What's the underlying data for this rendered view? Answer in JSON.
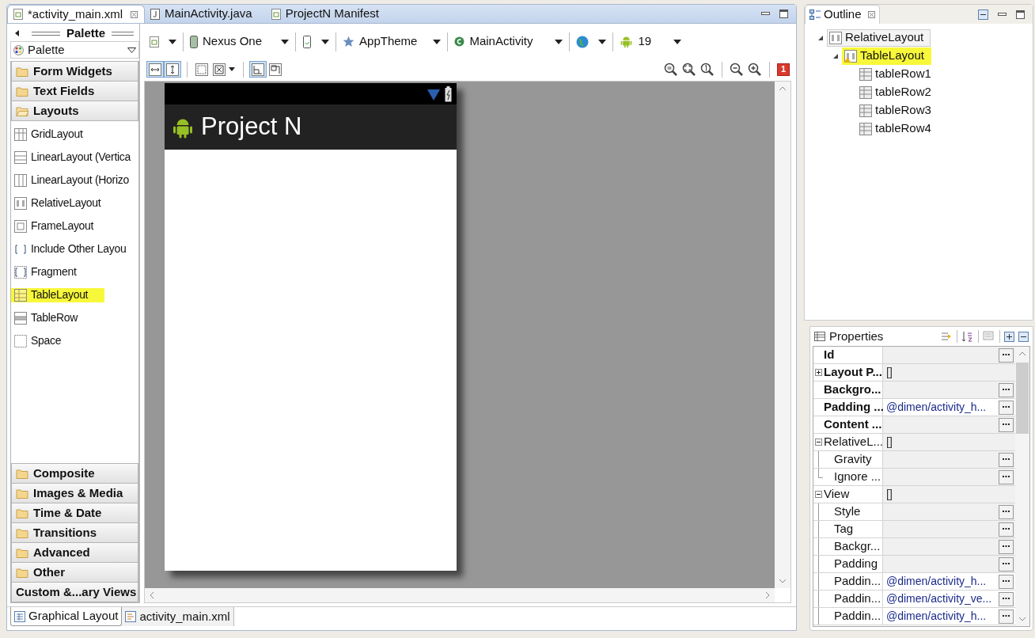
{
  "editor": {
    "tabs": [
      {
        "label": "*activity_main.xml",
        "selected": true
      },
      {
        "label": "MainActivity.java",
        "selected": false
      },
      {
        "label": "ProjectN Manifest",
        "selected": false
      }
    ],
    "palette": {
      "title": "Palette",
      "dropdown": "Palette",
      "groups": [
        {
          "label": "Form Widgets",
          "kind": "folder",
          "expanded": false
        },
        {
          "label": "Text Fields",
          "kind": "folder",
          "expanded": false
        },
        {
          "label": "Layouts",
          "kind": "folder",
          "expanded": true,
          "items": [
            {
              "label": "GridLayout",
              "highlighted": false
            },
            {
              "label": "LinearLayout (Vertica",
              "highlighted": false
            },
            {
              "label": "LinearLayout (Horizo",
              "highlighted": false
            },
            {
              "label": "RelativeLayout",
              "highlighted": false
            },
            {
              "label": "FrameLayout",
              "highlighted": false
            },
            {
              "label": "Include Other Layou",
              "highlighted": false
            },
            {
              "label": "Fragment",
              "highlighted": false
            },
            {
              "label": "TableLayout",
              "highlighted": true
            },
            {
              "label": "TableRow",
              "highlighted": false
            },
            {
              "label": "Space",
              "highlighted": false
            }
          ]
        },
        {
          "label": "Composite",
          "kind": "folder",
          "expanded": false
        },
        {
          "label": "Images & Media",
          "kind": "folder",
          "expanded": false
        },
        {
          "label": "Time & Date",
          "kind": "folder",
          "expanded": false
        },
        {
          "label": "Transitions",
          "kind": "folder",
          "expanded": false
        },
        {
          "label": "Advanced",
          "kind": "folder",
          "expanded": false
        },
        {
          "label": "Other",
          "kind": "folder",
          "expanded": false
        },
        {
          "label": "Custom &...ary Views",
          "kind": "custom"
        }
      ]
    },
    "toolbar": {
      "device": "Nexus One",
      "theme": "AppTheme",
      "activity": "MainActivity",
      "api": "19",
      "toggles": [
        {
          "selected": true
        },
        {
          "selected": true
        },
        {
          "selected": false
        },
        {
          "selected": false
        },
        {
          "selected": true
        },
        {
          "selected": false
        }
      ],
      "error_count": "1"
    },
    "preview": {
      "app_title": "Project N"
    },
    "bottom_tabs": [
      {
        "label": "Graphical Layout",
        "selected": true
      },
      {
        "label": "activity_main.xml",
        "selected": false
      }
    ]
  },
  "outline": {
    "title": "Outline",
    "tree": [
      {
        "label": "RelativeLayout",
        "selected": true,
        "highlighted": false,
        "expanded": true,
        "children": [
          {
            "label": "TableLayout",
            "selected": false,
            "highlighted": true,
            "warning": true,
            "expanded": true,
            "children": [
              {
                "label": "tableRow1",
                "selected": false,
                "highlighted": false
              },
              {
                "label": "tableRow2",
                "selected": false,
                "highlighted": false
              },
              {
                "label": "tableRow3",
                "selected": false,
                "highlighted": false
              },
              {
                "label": "tableRow4",
                "selected": false,
                "highlighted": false
              }
            ]
          }
        ]
      }
    ]
  },
  "properties": {
    "title": "Properties",
    "rows": [
      {
        "name": "Id",
        "bold": true
      },
      {
        "name": "Layout P...",
        "bold": true,
        "value": "[]",
        "expanded": false,
        "children": []
      },
      {
        "name": "Backgro...",
        "bold": true
      },
      {
        "name": "Padding ...",
        "bold": true,
        "value": "@dimen/activity_h..."
      },
      {
        "name": "Content ...",
        "bold": true
      },
      {
        "name": "RelativeL...",
        "bold": false,
        "value": "[]",
        "expanded": true,
        "children": [
          {
            "name": "Gravity",
            "bold": false
          },
          {
            "name": "Ignore ...",
            "bold": false
          }
        ]
      },
      {
        "name": "View",
        "bold": false,
        "value": "[]",
        "expanded": true,
        "children": [
          {
            "name": "Style",
            "bold": false
          },
          {
            "name": "Tag",
            "bold": false
          },
          {
            "name": "Backgr...",
            "bold": false
          },
          {
            "name": "Padding",
            "bold": false
          },
          {
            "name": "Paddin...",
            "bold": false,
            "value": "@dimen/activity_h..."
          },
          {
            "name": "Paddin...",
            "bold": false,
            "value": "@dimen/activity_ve..."
          },
          {
            "name": "Paddin...",
            "bold": false,
            "value": "@dimen/activity_h..."
          }
        ]
      }
    ]
  }
}
